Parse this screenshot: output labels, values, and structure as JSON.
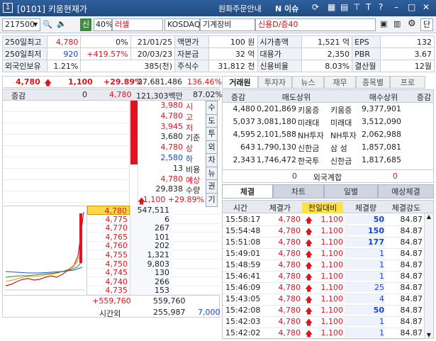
{
  "window": {
    "number": "1",
    "title": "[0101] 키움현재가",
    "right_links": [
      "원화주문안내",
      "N 이슈"
    ],
    "icons": [
      "link-icon",
      "grid-icon",
      "table-icon",
      "pin-icon",
      "T",
      "help-icon",
      "minimize-icon",
      "maximize-icon",
      "close-icon"
    ]
  },
  "toolbar": {
    "code": "217500",
    "tag1": "신",
    "margin": "40%",
    "name": "러셀",
    "market": "KOSDAQ",
    "sector": "기계장비",
    "credit": "신용D/증40",
    "btn_last": "단"
  },
  "info": {
    "rows": [
      [
        "250일최고",
        "4,780",
        "0%",
        "21/01/25",
        "액면가",
        "100 원",
        "시가총액",
        "1,521 억",
        "EPS",
        "132"
      ],
      [
        "250일최저",
        "920",
        "+419.57%",
        "20/03/23",
        "자본금",
        "32 억",
        "대용가",
        "2,350",
        "PBR",
        "3.67"
      ],
      [
        "외국인보유",
        "1.21%",
        "385(천)",
        "주식수",
        "31,812 천",
        "신용비율",
        "8.03%",
        "결산월",
        "12월"
      ]
    ]
  },
  "price_bar": {
    "price": "4,780",
    "change": "1,100",
    "rate": "+29.89%",
    "volume": "27,681,486",
    "vol_rate": "136.46%"
  },
  "left": {
    "header": {
      "label": "증감",
      "val": "0",
      "price": "4,780",
      "amount": "121,303백만",
      "pct": "87.02%"
    },
    "summary": [
      {
        "v": "3,980",
        "k": "시",
        "cls": "red"
      },
      {
        "v": "4,780",
        "k": "고",
        "cls": "red"
      },
      {
        "v": "3,945",
        "k": "저",
        "cls": "red"
      },
      {
        "v": "3,680",
        "k": "기준",
        "cls": ""
      },
      {
        "v": "4,780",
        "k": "상",
        "cls": "red"
      },
      {
        "v": "2,580",
        "k": "하",
        "cls": "blue"
      },
      {
        "v": "13",
        "k": "비용",
        "cls": ""
      },
      {
        "v": "4,780",
        "k": "예상",
        "cls": "red"
      },
      {
        "v": "29,838",
        "k": "수량",
        "cls": ""
      },
      {
        "v": "1,100 +29.89%",
        "k": "",
        "cls": "red"
      }
    ],
    "side_buttons": [
      "수",
      "도",
      "투",
      "외",
      "차",
      "뉴",
      "권",
      "기"
    ],
    "bids": [
      {
        "price": "4,780",
        "qty": "547,511"
      },
      {
        "price": "4,775",
        "qty": "6"
      },
      {
        "price": "4,770",
        "qty": "267"
      },
      {
        "price": "4,765",
        "qty": "101"
      },
      {
        "price": "4,760",
        "qty": "202"
      },
      {
        "price": "4,755",
        "qty": "1,321"
      },
      {
        "price": "4,750",
        "qty": "9,803"
      },
      {
        "price": "4,745",
        "qty": "130"
      },
      {
        "price": "4,740",
        "qty": "266"
      },
      {
        "price": "4,735",
        "qty": "153"
      }
    ],
    "footer": {
      "a": "+559,760",
      "b": "559,760",
      "c": "시간외",
      "d": "255,987",
      "e": "7,000"
    }
  },
  "broker": {
    "tabs": [
      "거래원",
      "투자자",
      "뉴스",
      "재무",
      "종목별",
      "프로"
    ],
    "head": [
      "증감",
      "매도상위",
      "매수상위",
      "증감"
    ],
    "rows": [
      [
        "4,480",
        "0,201,869",
        "키움증",
        "키움증",
        "9,377,901"
      ],
      [
        "5,037",
        "3,081,180",
        "미래대",
        "미래대",
        "3,512,090"
      ],
      [
        "4,595",
        "2,101,588",
        "NH투자",
        "NH투자",
        "2,062,988"
      ],
      [
        "643",
        "1,790,130",
        "신한금",
        "삼 성",
        "1,857,081"
      ],
      [
        "2,343",
        "1,746,472",
        "한국투",
        "신한금",
        "1,817,685"
      ]
    ],
    "foreign": {
      "left": "0",
      "label": "외국계합",
      "right": "0"
    }
  },
  "trades": {
    "tabs": [
      "체결",
      "차트",
      "일별",
      "예상체결"
    ],
    "head": [
      "시간",
      "체결가",
      "전일대비",
      "체결량",
      "체결강도"
    ],
    "rows": [
      [
        "15:58:17",
        "4,780",
        "1,100",
        "50",
        "84.87"
      ],
      [
        "15:54:48",
        "4,780",
        "1,100",
        "150",
        "84.87"
      ],
      [
        "15:51:08",
        "4,780",
        "1,100",
        "177",
        "84.87"
      ],
      [
        "15:49:01",
        "4,780",
        "1,100",
        "1",
        "84.87"
      ],
      [
        "15:48:59",
        "4,780",
        "1,100",
        "1",
        "84.87"
      ],
      [
        "15:46:41",
        "4,780",
        "1,100",
        "1",
        "84.87"
      ],
      [
        "15:46:09",
        "4,780",
        "1,100",
        "25",
        "84.87"
      ],
      [
        "15:43:05",
        "4,780",
        "1,100",
        "4",
        "84.87"
      ],
      [
        "15:42:08",
        "4,780",
        "1,100",
        "50",
        "84.87"
      ],
      [
        "15:42:03",
        "4,780",
        "1,100",
        "1",
        "84.87"
      ],
      [
        "15:42:02",
        "4,780",
        "1,100",
        "1",
        "84.87"
      ]
    ]
  },
  "colors": {
    "up": "#e0141e",
    "down": "#1546d6",
    "title": "#2f5f9c"
  }
}
